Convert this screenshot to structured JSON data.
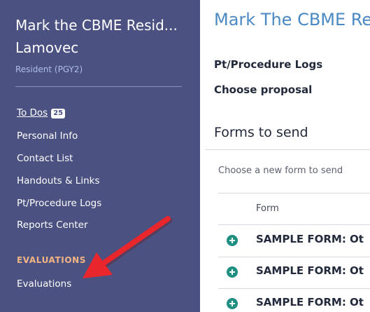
{
  "sidebar": {
    "name_line1": "Mark the CBME Resid...",
    "name_line2": "Lamovec",
    "role": "Resident (PGY2)",
    "items": [
      {
        "label": "To Dos",
        "badge": "25"
      },
      {
        "label": "Personal Info"
      },
      {
        "label": "Contact List"
      },
      {
        "label": "Handouts & Links"
      },
      {
        "label": "Pt/Procedure Logs"
      },
      {
        "label": "Reports Center"
      }
    ],
    "section_heading": "EVALUATIONS",
    "evaluations_item": "Evaluations"
  },
  "main": {
    "title": "Mark The CBME Re",
    "links": [
      "Pt/Procedure Logs",
      "Choose proposal"
    ],
    "section_title": "Forms to send",
    "choose_text": "Choose a new form to send",
    "column_header": "Form",
    "rows": [
      "SAMPLE FORM: Ot",
      "SAMPLE FORM: Ot",
      "SAMPLE FORM: Ot"
    ]
  },
  "colors": {
    "sidebar_bg": "#4b5282",
    "accent_title": "#4a89c3",
    "plus_icon": "#1e8f80",
    "section_heading": "#f2b482",
    "annotation_arrow": "#e8262b"
  },
  "icons": [
    "plus-circle-icon",
    "red-arrow-annotation"
  ]
}
